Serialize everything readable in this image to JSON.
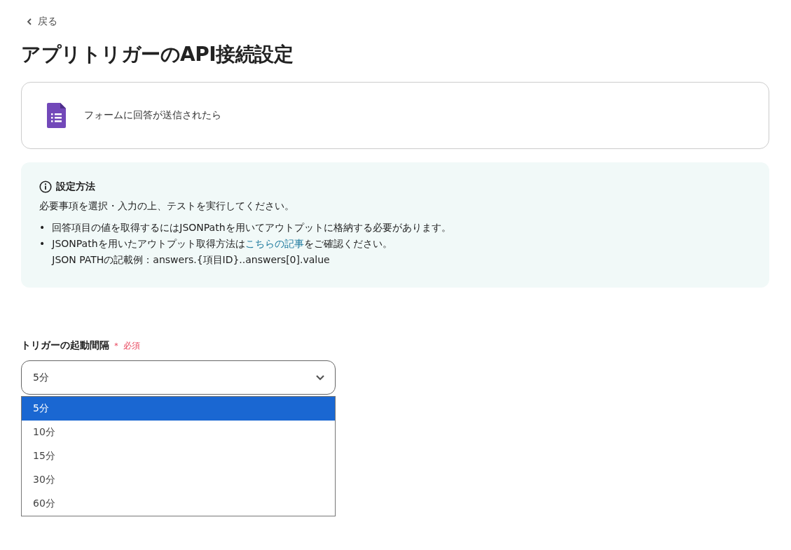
{
  "back": {
    "label": "戻る"
  },
  "title": "アプリトリガーのAPI接続設定",
  "trigger_card": {
    "label": "フォームに回答が送信されたら"
  },
  "info": {
    "heading": "設定方法",
    "text": "必要事項を選択・入力の上、テストを実行してください。",
    "bullets": [
      {
        "marker": "•",
        "text": "回答項目の値を取得するにはJSONPathを用いてアウトプットに格納する必要があります。"
      },
      {
        "marker": "•",
        "text": "JSONPathを用いたアウトプット取得方法は",
        "link": "こちらの記事",
        "after": "をご確認ください。",
        "extra": "JSON PATHの記載例：answers.{項目ID}..answers[0].value"
      }
    ]
  },
  "interval": {
    "label": "トリガーの起動間隔",
    "required_mark": "＊",
    "required": "必須",
    "value": "5分",
    "expanded": true,
    "options": [
      {
        "label": "5分",
        "selected": true
      },
      {
        "label": "10分",
        "selected": false
      },
      {
        "label": "15分",
        "selected": false
      },
      {
        "label": "30分",
        "selected": false
      },
      {
        "label": "60分",
        "selected": false
      }
    ]
  }
}
